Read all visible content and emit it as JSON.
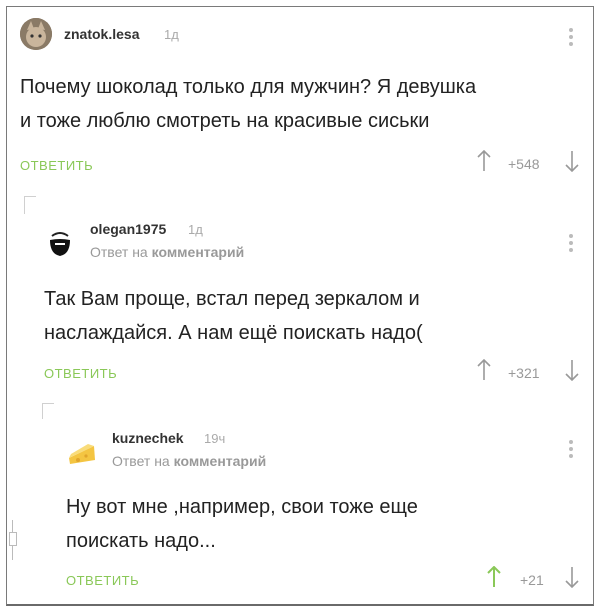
{
  "comments": [
    {
      "username": "znatok.lesa",
      "time": "1д",
      "text_line1": "Почему шоколад только для мужчин? Я девушка",
      "text_line2": "и тоже люблю смотреть на красивые сиськи",
      "reply_label": "ОТВЕТИТЬ",
      "rating": "+548",
      "avatar": "cat-avatar"
    },
    {
      "username": "olegan1975",
      "time": "1д",
      "reply_prefix": "Ответ на",
      "reply_target": "комментарий",
      "text_line1": "Так Вам проще, встал перед зеркалом и",
      "text_line2": "наслаждайся. А нам ещё поискать надо(",
      "reply_label": "ОТВЕТИТЬ",
      "rating": "+321",
      "avatar": "beard-avatar"
    },
    {
      "username": "kuznechek",
      "time": "19ч",
      "reply_prefix": "Ответ на",
      "reply_target": "комментарий",
      "text_line1": "Ну вот мне ,например, свои тоже еще",
      "text_line2": "поискать надо...",
      "reply_label": "ОТВЕТИТЬ",
      "rating": "+21",
      "avatar": "cheese-avatar"
    }
  ],
  "colors": {
    "accent_green": "#8ac858",
    "muted_gray": "#999999",
    "text": "#222222"
  }
}
